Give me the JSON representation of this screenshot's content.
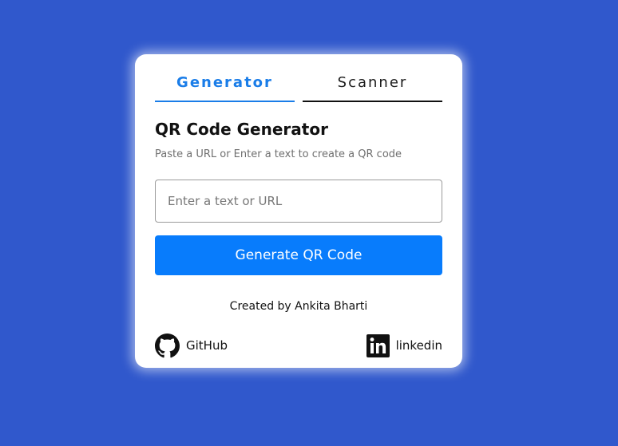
{
  "tabs": [
    {
      "label": "Generator",
      "active": true
    },
    {
      "label": "Scanner",
      "active": false
    }
  ],
  "main": {
    "heading": "QR Code Generator",
    "subtitle": "Paste a URL or Enter a text to create a QR code",
    "input_placeholder": "Enter a text or URL",
    "input_value": "",
    "button_label": "Generate QR Code"
  },
  "footer": {
    "credit": "Created by Ankita Bharti",
    "github_label": "GitHub",
    "github_icon": "github-icon",
    "linkedin_label": "linkedin",
    "linkedin_icon": "linkedin-icon"
  },
  "colors": {
    "background": "#3058cc",
    "accent": "#087cfc",
    "active_tab": "#1a7de8"
  }
}
